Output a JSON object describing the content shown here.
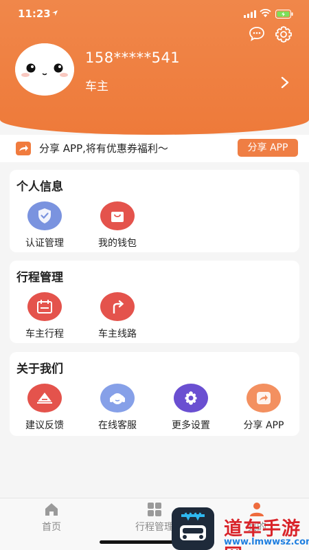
{
  "status": {
    "time": "11:23"
  },
  "profile": {
    "phone": "158*****541",
    "role": "车主"
  },
  "share_banner": {
    "text": "分享 APP,将有优惠券福利～",
    "button": "分享 APP"
  },
  "sections": [
    {
      "title": "个人信息",
      "items": [
        {
          "label": "认证管理",
          "icon": "shield-check-icon",
          "color": "#6f88da"
        },
        {
          "label": "我的钱包",
          "icon": "bag-icon",
          "color": "#e4534c"
        }
      ]
    },
    {
      "title": "行程管理",
      "items": [
        {
          "label": "车主行程",
          "icon": "calendar-icon",
          "color": "#e4534c"
        },
        {
          "label": "车主线路",
          "icon": "route-arrow-icon",
          "color": "#e4534c"
        }
      ]
    },
    {
      "title": "关于我们",
      "items": [
        {
          "label": "建议反馈",
          "icon": "feedback-icon",
          "color": "#e4534c"
        },
        {
          "label": "在线客服",
          "icon": "headset-icon",
          "color": "#7f9be6"
        },
        {
          "label": "更多设置",
          "icon": "gear-icon",
          "color": "#6a4fd1"
        },
        {
          "label": "分享 APP",
          "icon": "share-icon",
          "color": "#f08a52"
        }
      ]
    }
  ],
  "tabs": [
    {
      "label": "首页",
      "icon": "home-icon"
    },
    {
      "label": "行程管理",
      "icon": "grid-icon"
    },
    {
      "label": "我的",
      "icon": "user-icon"
    }
  ],
  "watermark": {
    "title": "道车手游网",
    "url": "www.lmwwsz.com"
  }
}
